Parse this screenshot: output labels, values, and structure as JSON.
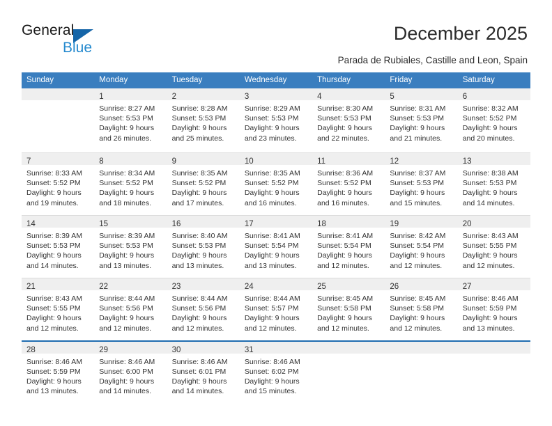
{
  "brand": {
    "name_top": "General",
    "name_bottom": "Blue",
    "triangle_color": "#1565a8",
    "blue_text_color": "#2489ce"
  },
  "header": {
    "title": "December 2025",
    "subtitle": "Parada de Rubiales, Castille and Leon, Spain"
  },
  "theme": {
    "header_blue": "#3a7ebf",
    "band_gray": "#efefef",
    "rule_blue": "#1f6cb0",
    "text": "#333333"
  },
  "weekdays": [
    "Sunday",
    "Monday",
    "Tuesday",
    "Wednesday",
    "Thursday",
    "Friday",
    "Saturday"
  ],
  "weeks": [
    [
      {
        "day": "",
        "lines": []
      },
      {
        "day": "1",
        "lines": [
          "Sunrise: 8:27 AM",
          "Sunset: 5:53 PM",
          "Daylight: 9 hours",
          "and 26 minutes."
        ]
      },
      {
        "day": "2",
        "lines": [
          "Sunrise: 8:28 AM",
          "Sunset: 5:53 PM",
          "Daylight: 9 hours",
          "and 25 minutes."
        ]
      },
      {
        "day": "3",
        "lines": [
          "Sunrise: 8:29 AM",
          "Sunset: 5:53 PM",
          "Daylight: 9 hours",
          "and 23 minutes."
        ]
      },
      {
        "day": "4",
        "lines": [
          "Sunrise: 8:30 AM",
          "Sunset: 5:53 PM",
          "Daylight: 9 hours",
          "and 22 minutes."
        ]
      },
      {
        "day": "5",
        "lines": [
          "Sunrise: 8:31 AM",
          "Sunset: 5:53 PM",
          "Daylight: 9 hours",
          "and 21 minutes."
        ]
      },
      {
        "day": "6",
        "lines": [
          "Sunrise: 8:32 AM",
          "Sunset: 5:52 PM",
          "Daylight: 9 hours",
          "and 20 minutes."
        ]
      }
    ],
    [
      {
        "day": "7",
        "lines": [
          "Sunrise: 8:33 AM",
          "Sunset: 5:52 PM",
          "Daylight: 9 hours",
          "and 19 minutes."
        ]
      },
      {
        "day": "8",
        "lines": [
          "Sunrise: 8:34 AM",
          "Sunset: 5:52 PM",
          "Daylight: 9 hours",
          "and 18 minutes."
        ]
      },
      {
        "day": "9",
        "lines": [
          "Sunrise: 8:35 AM",
          "Sunset: 5:52 PM",
          "Daylight: 9 hours",
          "and 17 minutes."
        ]
      },
      {
        "day": "10",
        "lines": [
          "Sunrise: 8:35 AM",
          "Sunset: 5:52 PM",
          "Daylight: 9 hours",
          "and 16 minutes."
        ]
      },
      {
        "day": "11",
        "lines": [
          "Sunrise: 8:36 AM",
          "Sunset: 5:52 PM",
          "Daylight: 9 hours",
          "and 16 minutes."
        ]
      },
      {
        "day": "12",
        "lines": [
          "Sunrise: 8:37 AM",
          "Sunset: 5:53 PM",
          "Daylight: 9 hours",
          "and 15 minutes."
        ]
      },
      {
        "day": "13",
        "lines": [
          "Sunrise: 8:38 AM",
          "Sunset: 5:53 PM",
          "Daylight: 9 hours",
          "and 14 minutes."
        ]
      }
    ],
    [
      {
        "day": "14",
        "lines": [
          "Sunrise: 8:39 AM",
          "Sunset: 5:53 PM",
          "Daylight: 9 hours",
          "and 14 minutes."
        ]
      },
      {
        "day": "15",
        "lines": [
          "Sunrise: 8:39 AM",
          "Sunset: 5:53 PM",
          "Daylight: 9 hours",
          "and 13 minutes."
        ]
      },
      {
        "day": "16",
        "lines": [
          "Sunrise: 8:40 AM",
          "Sunset: 5:53 PM",
          "Daylight: 9 hours",
          "and 13 minutes."
        ]
      },
      {
        "day": "17",
        "lines": [
          "Sunrise: 8:41 AM",
          "Sunset: 5:54 PM",
          "Daylight: 9 hours",
          "and 13 minutes."
        ]
      },
      {
        "day": "18",
        "lines": [
          "Sunrise: 8:41 AM",
          "Sunset: 5:54 PM",
          "Daylight: 9 hours",
          "and 12 minutes."
        ]
      },
      {
        "day": "19",
        "lines": [
          "Sunrise: 8:42 AM",
          "Sunset: 5:54 PM",
          "Daylight: 9 hours",
          "and 12 minutes."
        ]
      },
      {
        "day": "20",
        "lines": [
          "Sunrise: 8:43 AM",
          "Sunset: 5:55 PM",
          "Daylight: 9 hours",
          "and 12 minutes."
        ]
      }
    ],
    [
      {
        "day": "21",
        "lines": [
          "Sunrise: 8:43 AM",
          "Sunset: 5:55 PM",
          "Daylight: 9 hours",
          "and 12 minutes."
        ]
      },
      {
        "day": "22",
        "lines": [
          "Sunrise: 8:44 AM",
          "Sunset: 5:56 PM",
          "Daylight: 9 hours",
          "and 12 minutes."
        ]
      },
      {
        "day": "23",
        "lines": [
          "Sunrise: 8:44 AM",
          "Sunset: 5:56 PM",
          "Daylight: 9 hours",
          "and 12 minutes."
        ]
      },
      {
        "day": "24",
        "lines": [
          "Sunrise: 8:44 AM",
          "Sunset: 5:57 PM",
          "Daylight: 9 hours",
          "and 12 minutes."
        ]
      },
      {
        "day": "25",
        "lines": [
          "Sunrise: 8:45 AM",
          "Sunset: 5:58 PM",
          "Daylight: 9 hours",
          "and 12 minutes."
        ]
      },
      {
        "day": "26",
        "lines": [
          "Sunrise: 8:45 AM",
          "Sunset: 5:58 PM",
          "Daylight: 9 hours",
          "and 12 minutes."
        ]
      },
      {
        "day": "27",
        "lines": [
          "Sunrise: 8:46 AM",
          "Sunset: 5:59 PM",
          "Daylight: 9 hours",
          "and 13 minutes."
        ]
      }
    ],
    [
      {
        "day": "28",
        "lines": [
          "Sunrise: 8:46 AM",
          "Sunset: 5:59 PM",
          "Daylight: 9 hours",
          "and 13 minutes."
        ]
      },
      {
        "day": "29",
        "lines": [
          "Sunrise: 8:46 AM",
          "Sunset: 6:00 PM",
          "Daylight: 9 hours",
          "and 14 minutes."
        ]
      },
      {
        "day": "30",
        "lines": [
          "Sunrise: 8:46 AM",
          "Sunset: 6:01 PM",
          "Daylight: 9 hours",
          "and 14 minutes."
        ]
      },
      {
        "day": "31",
        "lines": [
          "Sunrise: 8:46 AM",
          "Sunset: 6:02 PM",
          "Daylight: 9 hours",
          "and 15 minutes."
        ]
      },
      {
        "day": "",
        "lines": []
      },
      {
        "day": "",
        "lines": []
      },
      {
        "day": "",
        "lines": []
      }
    ]
  ]
}
